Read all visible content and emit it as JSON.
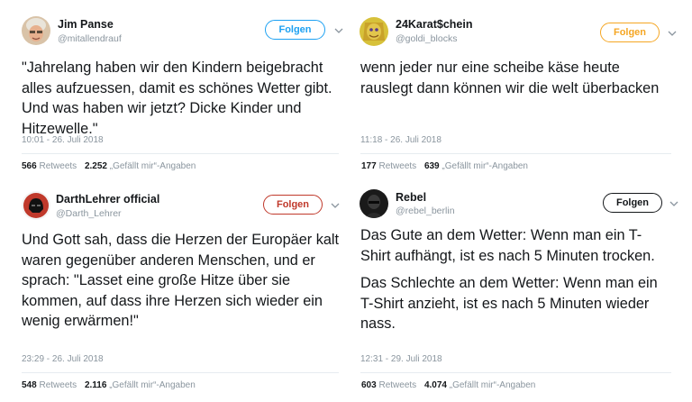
{
  "tweets": [
    {
      "name": "Jim Panse",
      "handle": "@mitallendrauf",
      "follow_label": "Folgen",
      "text": "\"Jahrelang haben wir den Kindern beigebracht alles aufzuessen, damit es schönes Wetter gibt. Und was haben wir jetzt? Dicke Kinder und Hitzewelle.\"",
      "time": "10:01 - 26. Juli 2018",
      "retweets": "566",
      "retweets_label": "Retweets",
      "likes": "2.252",
      "likes_label": "„Gefällt mir“-Angaben",
      "accent": "#1da1f2"
    },
    {
      "name": "24Karat$chein",
      "handle": "@goldi_blocks",
      "follow_label": "Folgen",
      "text": "wenn jeder nur eine scheibe käse heute rauslegt dann können wir die welt überbacken",
      "time": "11:18 - 26. Juli 2018",
      "retweets": "177",
      "retweets_label": "Retweets",
      "likes": "639",
      "likes_label": "„Gefällt mir“-Angaben",
      "accent": "#f5a623"
    },
    {
      "name": "DarthLehrer official",
      "handle": "@Darth_Lehrer",
      "follow_label": "Folgen",
      "text": "Und Gott sah, dass die Herzen der Europäer kalt waren gegenüber anderen Menschen, und er sprach: \"Lasset eine große Hitze über sie kommen, auf dass ihre Herzen sich wieder ein wenig erwärmen!\"",
      "time": "23:29 - 26. Juli 2018",
      "retweets": "548",
      "retweets_label": "Retweets",
      "likes": "2.116",
      "likes_label": "„Gefällt mir“-Angaben",
      "accent": "#c0392b"
    },
    {
      "name": "Rebel",
      "handle": "@rebel_berlin",
      "follow_label": "Folgen",
      "text_p1": "Das Gute an dem Wetter: Wenn man ein T-Shirt aufhängt, ist es nach 5 Minuten trocken.",
      "text_p2": "Das Schlechte an dem Wetter: Wenn man ein T-Shirt anzieht, ist es nach 5 Minuten wieder nass.",
      "time": "12:31 - 29. Juli 2018",
      "retweets": "603",
      "retweets_label": "Retweets",
      "likes": "4.074",
      "likes_label": "„Gefällt mir“-Angaben",
      "accent": "#14171a"
    }
  ]
}
